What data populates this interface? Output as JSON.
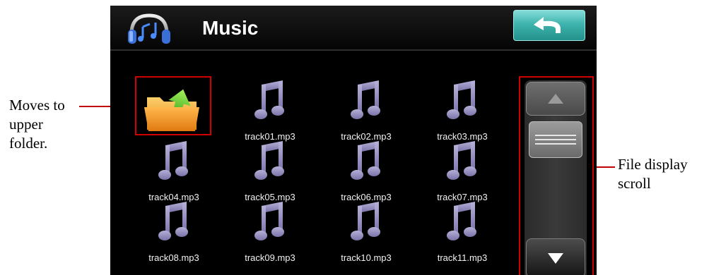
{
  "header": {
    "title": "Music"
  },
  "icons": {
    "app": "headphones-icon",
    "back": "back-arrow-icon",
    "folder": "folder-up-icon",
    "file": "music-note-icon"
  },
  "files": [
    "track01.mp3",
    "track02.mp3",
    "track03.mp3",
    "track04.mp3",
    "track05.mp3",
    "track06.mp3",
    "track07.mp3",
    "track08.mp3",
    "track09.mp3",
    "track10.mp3",
    "track11.mp3"
  ],
  "callouts": {
    "upper_folder_line1": "Moves to",
    "upper_folder_line2": "upper",
    "upper_folder_line3": "folder.",
    "scroll_line1": "File display",
    "scroll_line2": "scroll"
  },
  "colors": {
    "screen_bg": "#000000",
    "back_button": "#3fb3ad",
    "note_icon": "#8d86b8",
    "highlight": "#d00000"
  }
}
